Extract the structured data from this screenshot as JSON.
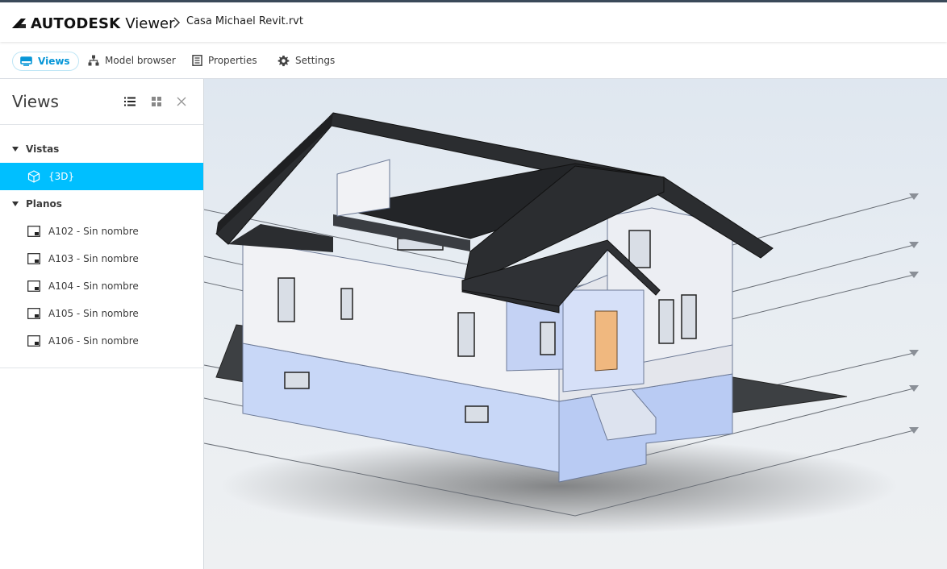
{
  "header": {
    "brand": "AUTODESK",
    "product": "Viewer",
    "file_name": "Casa Michael Revit.rvt"
  },
  "toolbar": {
    "tabs": [
      {
        "label": "Views",
        "icon": "monitor-icon",
        "active": true
      },
      {
        "label": "Model browser",
        "icon": "hierarchy-icon",
        "active": false
      },
      {
        "label": "Properties",
        "icon": "document-icon",
        "active": false
      },
      {
        "label": "Settings",
        "icon": "gear-icon",
        "active": false
      }
    ]
  },
  "panel": {
    "title": "Views",
    "groups": [
      {
        "label": "Vistas",
        "items": [
          {
            "label": "{3D}",
            "icon": "cube-icon",
            "selected": true
          }
        ]
      },
      {
        "label": "Planos",
        "items": [
          {
            "label": "A102 - Sin nombre",
            "icon": "sheet-icon"
          },
          {
            "label": "A103 - Sin nombre",
            "icon": "sheet-icon"
          },
          {
            "label": "A104 - Sin nombre",
            "icon": "sheet-icon"
          },
          {
            "label": "A105 - Sin nombre",
            "icon": "sheet-icon"
          },
          {
            "label": "A106 - Sin nombre",
            "icon": "sheet-icon"
          }
        ]
      }
    ]
  },
  "colors": {
    "accent": "#0696d7",
    "selection": "#00bfff",
    "roof": "#2b2d30",
    "wall": "#f1f2f5",
    "foundation": "#c9d8f8"
  }
}
